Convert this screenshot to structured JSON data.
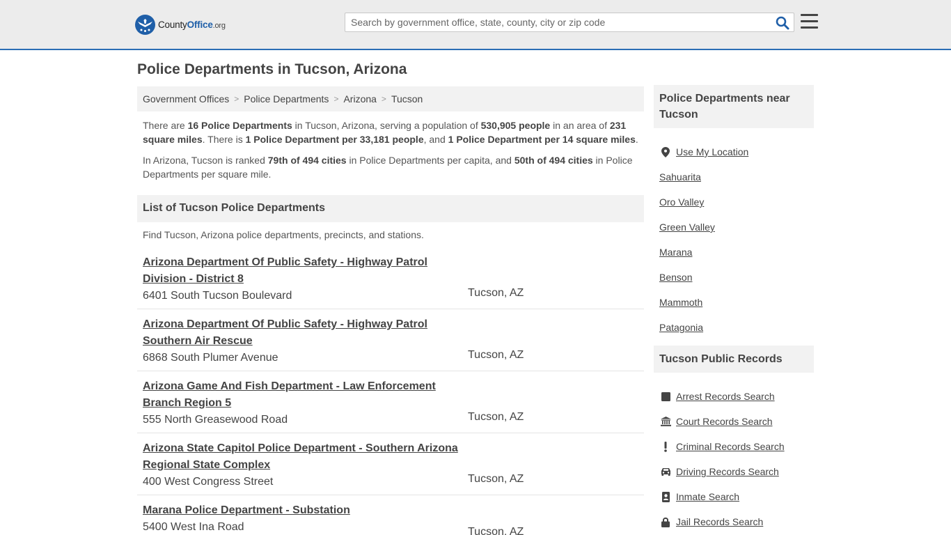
{
  "header": {
    "logo_county": "County",
    "logo_office": "Office",
    "logo_org": ".org",
    "search_placeholder": "Search by government office, state, county, city or zip code"
  },
  "page_title": "Police Departments in Tucson, Arizona",
  "breadcrumb": [
    "Government Offices",
    "Police Departments",
    "Arizona",
    "Tucson"
  ],
  "intro": {
    "p1": {
      "t1": "There are ",
      "b1": "16 Police Departments",
      "t2": " in Tucson, Arizona, serving a population of ",
      "b2": "530,905 people",
      "t3": " in an area of ",
      "b3": "231 square miles",
      "t4": ". There is ",
      "b4": "1 Police Department per 33,181 people",
      "t5": ", and ",
      "b5": "1 Police Department per 14 square miles",
      "t6": "."
    },
    "p2": {
      "t1": "In Arizona, Tucson is ranked ",
      "b1": "79th of 494 cities",
      "t2": " in Police Departments per capita, and ",
      "b2": "50th of 494 cities",
      "t3": " in Police Departments per square mile."
    }
  },
  "list_section": {
    "title": "List of Tucson Police Departments",
    "description": "Find Tucson, Arizona police departments, precincts, and stations.",
    "items": [
      {
        "name": "Arizona Department Of Public Safety - Highway Patrol Division - District 8",
        "address": "6401 South Tucson Boulevard",
        "city": "Tucson, AZ"
      },
      {
        "name": "Arizona Department Of Public Safety - Highway Patrol Southern Air Rescue",
        "address": "6868 South Plumer Avenue",
        "city": "Tucson, AZ"
      },
      {
        "name": "Arizona Game And Fish Department - Law Enforcement Branch Region 5",
        "address": "555 North Greasewood Road",
        "city": "Tucson, AZ"
      },
      {
        "name": "Arizona State Capitol Police Department - Southern Arizona Regional State Complex",
        "address": "400 West Congress Street",
        "city": "Tucson, AZ"
      },
      {
        "name": "Marana Police Department - Substation",
        "address": "5400 West Ina Road",
        "city": "Tucson, AZ"
      }
    ]
  },
  "sidebar": {
    "nearby_title": "Police Departments near Tucson",
    "use_location": "Use My Location",
    "nearby": [
      "Sahuarita",
      "Oro Valley",
      "Green Valley",
      "Marana",
      "Benson",
      "Mammoth",
      "Patagonia"
    ],
    "records_title": "Tucson Public Records",
    "records": [
      {
        "label": "Arrest Records Search",
        "icon": "square-icon"
      },
      {
        "label": "Court Records Search",
        "icon": "courthouse-icon"
      },
      {
        "label": "Criminal Records Search",
        "icon": "exclamation-icon"
      },
      {
        "label": "Driving Records Search",
        "icon": "car-icon"
      },
      {
        "label": "Inmate Search",
        "icon": "id-badge-icon"
      },
      {
        "label": "Jail Records Search",
        "icon": "lock-icon"
      }
    ]
  },
  "colors": {
    "brand_blue": "#1f5fa8",
    "header_bg": "#ececec",
    "panel_bg": "#f2f2f2",
    "text": "#444444"
  }
}
